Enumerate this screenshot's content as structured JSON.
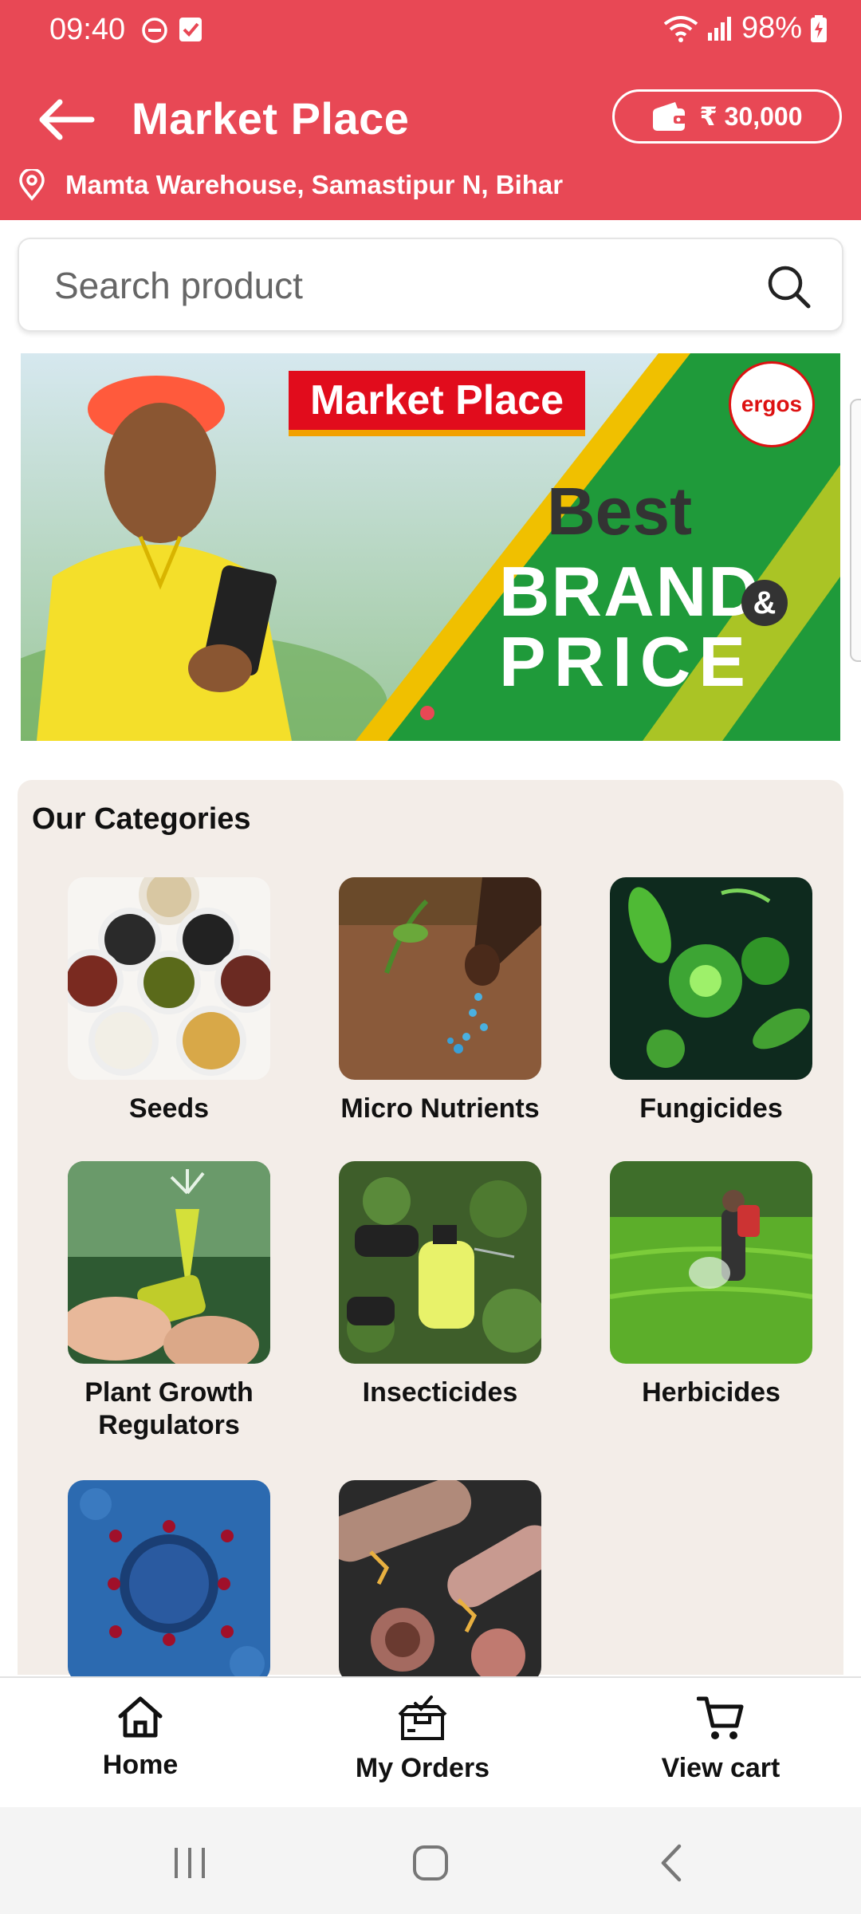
{
  "status_bar": {
    "time": "09:40",
    "battery": "98%",
    "icons": [
      "do-not-disturb-icon",
      "checkbox-icon",
      "wifi-icon",
      "signal-icon",
      "battery-charging-icon"
    ]
  },
  "header": {
    "title": "Market Place",
    "wallet_amount": "₹ 30,000",
    "location": "Mamta Warehouse, Samastipur N, Bihar",
    "background_color": "#e84855"
  },
  "search": {
    "placeholder": "Search product"
  },
  "banner": {
    "label": "Market Place",
    "line1": "Best",
    "line2": "BRAND",
    "amp": "&",
    "line3": "PRICE",
    "logo_text": "ergos",
    "active_slide": 1
  },
  "categories": {
    "title": "Our Categories",
    "items": [
      {
        "label": "Seeds"
      },
      {
        "label": "Micro Nutrients"
      },
      {
        "label": "Fungicides"
      },
      {
        "label": "Plant Growth Regulators"
      },
      {
        "label": "Insecticides"
      },
      {
        "label": "Herbicides"
      },
      {
        "label": ""
      },
      {
        "label": ""
      }
    ]
  },
  "bottom_nav": {
    "items": [
      {
        "label": "Home",
        "icon": "home-icon"
      },
      {
        "label": "My Orders",
        "icon": "orders-box-icon"
      },
      {
        "label": "View cart",
        "icon": "cart-icon"
      }
    ]
  },
  "system_nav": {
    "icons": [
      "recent-apps-icon",
      "home-circle-icon",
      "system-back-icon"
    ]
  },
  "colors": {
    "accent": "#e84855",
    "category_bg": "#f3ede8",
    "banner_green": "#1f9a3a"
  }
}
